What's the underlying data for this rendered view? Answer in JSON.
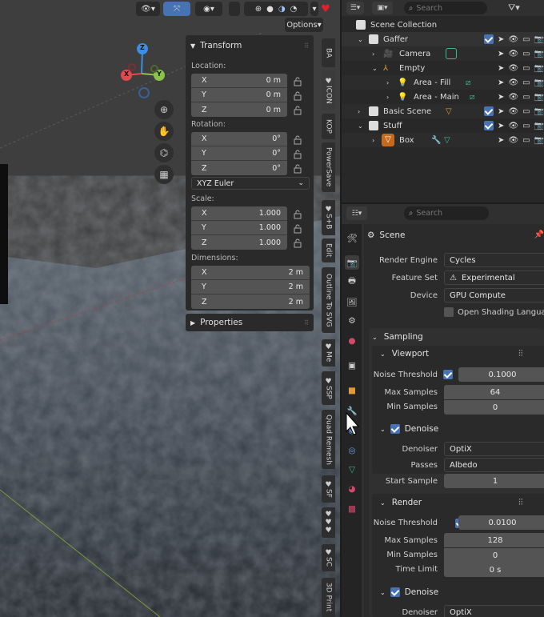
{
  "viewport": {
    "options_label": "Options",
    "npanel": {
      "transform_title": "Transform",
      "location_label": "Location:",
      "location": [
        {
          "axis": "X",
          "value": "0 m"
        },
        {
          "axis": "Y",
          "value": "0 m"
        },
        {
          "axis": "Z",
          "value": "0 m"
        }
      ],
      "rotation_label": "Rotation:",
      "rotation": [
        {
          "axis": "X",
          "value": "0°"
        },
        {
          "axis": "Y",
          "value": "0°"
        },
        {
          "axis": "Z",
          "value": "0°"
        }
      ],
      "rotation_mode": "XYZ Euler",
      "scale_label": "Scale:",
      "scale": [
        {
          "axis": "X",
          "value": "1.000"
        },
        {
          "axis": "Y",
          "value": "1.000"
        },
        {
          "axis": "Z",
          "value": "1.000"
        }
      ],
      "dimensions_label": "Dimensions:",
      "dimensions": [
        {
          "axis": "X",
          "value": "2 m"
        },
        {
          "axis": "Y",
          "value": "2 m"
        },
        {
          "axis": "Z",
          "value": "2 m"
        }
      ],
      "properties_title": "Properties"
    },
    "gizmo": {
      "x": "X",
      "y": "Y",
      "z": "Z"
    },
    "vertical_tabs": [
      "BA",
      "♥ICON",
      "KOP",
      "PowerSave",
      "♥S+B",
      "Edit",
      "Outline To SVG",
      "♥Me",
      "♥SSP",
      "Quad Remesh",
      "♥SF",
      "♥♥♥",
      "♥SC",
      "3D Print"
    ]
  },
  "outliner": {
    "search_placeholder": "Search",
    "items": [
      {
        "label": "Scene Collection"
      },
      {
        "label": "Gaffer"
      },
      {
        "label": "Camera"
      },
      {
        "label": "Empty"
      },
      {
        "label": "Area - Fill"
      },
      {
        "label": "Area - Main"
      },
      {
        "label": "Basic Scene"
      },
      {
        "label": "Stuff"
      },
      {
        "label": "Box"
      }
    ]
  },
  "properties": {
    "search_placeholder": "Search",
    "context_title": "Scene",
    "render_engine_label": "Render Engine",
    "render_engine_value": "Cycles",
    "feature_set_label": "Feature Set",
    "feature_set_value": "Experimental",
    "device_label": "Device",
    "device_value": "GPU Compute",
    "osl_label": "Open Shading Language",
    "sampling_title": "Sampling",
    "viewport_title": "Viewport",
    "vp_noise_label": "Noise Threshold",
    "vp_noise_value": "0.1000",
    "vp_max_label": "Max Samples",
    "vp_max_value": "64",
    "vp_min_label": "Min Samples",
    "vp_min_value": "0",
    "vp_denoise_title": "Denoise",
    "vp_denoiser_label": "Denoiser",
    "vp_denoiser_value": "OptiX",
    "vp_passes_label": "Passes",
    "vp_passes_value": "Albedo",
    "vp_start_label": "Start Sample",
    "vp_start_value": "1",
    "render_title": "Render",
    "r_noise_label": "Noise Threshold",
    "r_noise_value": "0.0100",
    "r_max_label": "Max Samples",
    "r_max_value": "128",
    "r_min_label": "Min Samples",
    "r_min_value": "0",
    "r_time_label": "Time Limit",
    "r_time_value": "0 s",
    "r_denoise_title": "Denoise",
    "r_denoiser_label": "Denoiser",
    "r_denoiser_value": "OptiX"
  },
  "colors": {
    "accent": "#4772b3",
    "x_axis": "#e5474f",
    "y_axis": "#8bc34a",
    "z_axis": "#3b8ee0",
    "heart": "#e0202b"
  }
}
